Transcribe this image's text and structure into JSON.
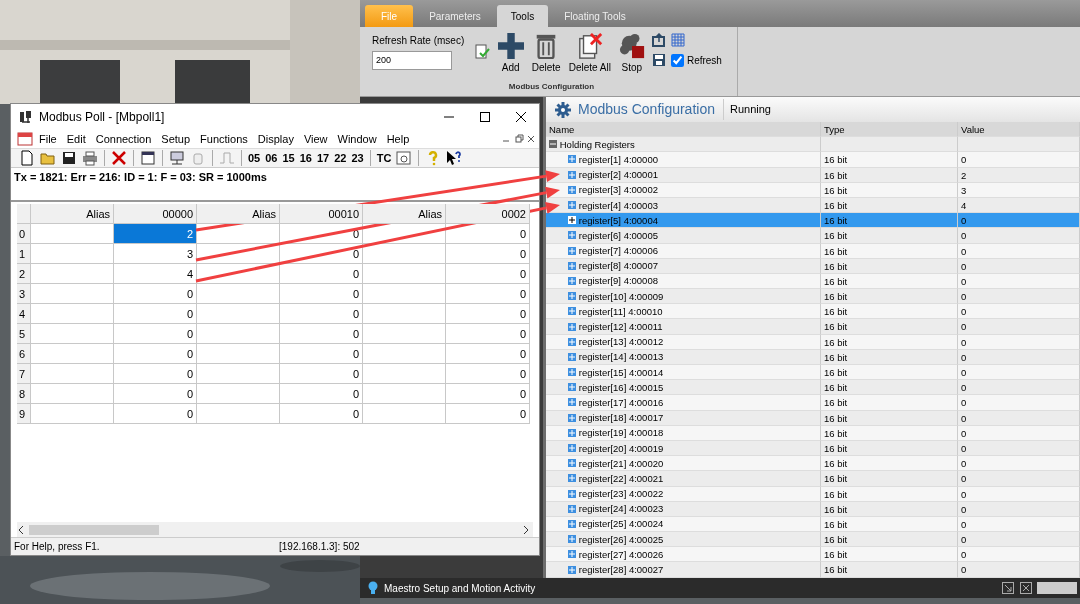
{
  "ribbon": {
    "file_button": "File",
    "tabs": [
      {
        "label": "Parameters",
        "selected": false
      },
      {
        "label": "Tools",
        "selected": true
      },
      {
        "label": "Floating Tools",
        "selected": false
      }
    ],
    "refresh_rate": {
      "label": "Refresh Rate (msec)",
      "value": "200"
    },
    "tools": [
      {
        "label": "Add",
        "kind": "add"
      },
      {
        "label": "Delete",
        "kind": "delete"
      },
      {
        "label": "Delete All",
        "kind": "delete_all"
      },
      {
        "label": "Stop",
        "kind": "stop"
      }
    ],
    "refresh_checkbox": {
      "label": "Refresh",
      "checked": true
    },
    "group_label": "Modbus Configuration"
  },
  "config": {
    "title": "Modbus Configuration",
    "status": "Running",
    "columns": [
      "Name",
      "Type",
      "Value"
    ],
    "group": {
      "label": "Holding Registers",
      "expanded": true
    },
    "rows": [
      {
        "name": "register[1] 4:00000",
        "type": "16 bit",
        "value": "0",
        "selected": false
      },
      {
        "name": "register[2] 4:00001",
        "type": "16 bit",
        "value": "2",
        "selected": false
      },
      {
        "name": "register[3] 4:00002",
        "type": "16 bit",
        "value": "3",
        "selected": false
      },
      {
        "name": "register[4] 4:00003",
        "type": "16 bit",
        "value": "4",
        "selected": false
      },
      {
        "name": "register[5] 4:00004",
        "type": "16 bit",
        "value": "0",
        "selected": true
      },
      {
        "name": "register[6] 4:00005",
        "type": "16 bit",
        "value": "0",
        "selected": false
      },
      {
        "name": "register[7] 4:00006",
        "type": "16 bit",
        "value": "0",
        "selected": false
      },
      {
        "name": "register[8] 4:00007",
        "type": "16 bit",
        "value": "0",
        "selected": false
      },
      {
        "name": "register[9] 4:00008",
        "type": "16 bit",
        "value": "0",
        "selected": false
      },
      {
        "name": "register[10] 4:00009",
        "type": "16 bit",
        "value": "0",
        "selected": false
      },
      {
        "name": "register[11] 4:00010",
        "type": "16 bit",
        "value": "0",
        "selected": false
      },
      {
        "name": "register[12] 4:00011",
        "type": "16 bit",
        "value": "0",
        "selected": false
      },
      {
        "name": "register[13] 4:00012",
        "type": "16 bit",
        "value": "0",
        "selected": false
      },
      {
        "name": "register[14] 4:00013",
        "type": "16 bit",
        "value": "0",
        "selected": false
      },
      {
        "name": "register[15] 4:00014",
        "type": "16 bit",
        "value": "0",
        "selected": false
      },
      {
        "name": "register[16] 4:00015",
        "type": "16 bit",
        "value": "0",
        "selected": false
      },
      {
        "name": "register[17] 4:00016",
        "type": "16 bit",
        "value": "0",
        "selected": false
      },
      {
        "name": "register[18] 4:00017",
        "type": "16 bit",
        "value": "0",
        "selected": false
      },
      {
        "name": "register[19] 4:00018",
        "type": "16 bit",
        "value": "0",
        "selected": false
      },
      {
        "name": "register[20] 4:00019",
        "type": "16 bit",
        "value": "0",
        "selected": false
      },
      {
        "name": "register[21] 4:00020",
        "type": "16 bit",
        "value": "0",
        "selected": false
      },
      {
        "name": "register[22] 4:00021",
        "type": "16 bit",
        "value": "0",
        "selected": false
      },
      {
        "name": "register[23] 4:00022",
        "type": "16 bit",
        "value": "0",
        "selected": false
      },
      {
        "name": "register[24] 4:00023",
        "type": "16 bit",
        "value": "0",
        "selected": false
      },
      {
        "name": "register[25] 4:00024",
        "type": "16 bit",
        "value": "0",
        "selected": false
      },
      {
        "name": "register[26] 4:00025",
        "type": "16 bit",
        "value": "0",
        "selected": false
      },
      {
        "name": "register[27] 4:00026",
        "type": "16 bit",
        "value": "0",
        "selected": false
      },
      {
        "name": "register[28] 4:00027",
        "type": "16 bit",
        "value": "0",
        "selected": false
      }
    ]
  },
  "activity_bar": {
    "title": "Maestro Setup and Motion Activity"
  },
  "poll": {
    "title": "Modbus Poll - [Mbpoll1]",
    "menu": [
      "File",
      "Edit",
      "Connection",
      "Setup",
      "Functions",
      "Display",
      "View",
      "Window",
      "Help"
    ],
    "function_codes": [
      "05",
      "06",
      "15",
      "16",
      "17",
      "22",
      "23"
    ],
    "test_button": "TC",
    "status_line": "Tx = 1821: Err = 216: ID = 1: F = 03: SR = 1000ms",
    "columns": [
      "Alias",
      "00000",
      "Alias",
      "00010",
      "Alias",
      "0002"
    ],
    "rows": [
      {
        "label": "0",
        "cells": [
          {
            "selected": false
          },
          {
            "value": "2",
            "selected": true
          },
          {
            "selected": false
          },
          {
            "value": "0",
            "selected": false
          },
          {
            "selected": false
          },
          {
            "value": "0",
            "selected": false
          }
        ]
      },
      {
        "label": "1",
        "cells": [
          {
            "selected": false
          },
          {
            "value": "3",
            "selected": false
          },
          {
            "selected": false
          },
          {
            "value": "0",
            "selected": false
          },
          {
            "selected": false
          },
          {
            "value": "0",
            "selected": false
          }
        ]
      },
      {
        "label": "2",
        "cells": [
          {
            "selected": false
          },
          {
            "value": "4",
            "selected": false
          },
          {
            "selected": false
          },
          {
            "value": "0",
            "selected": false
          },
          {
            "selected": false
          },
          {
            "value": "0",
            "selected": false
          }
        ]
      },
      {
        "label": "3",
        "cells": [
          {
            "selected": false
          },
          {
            "value": "0",
            "selected": false
          },
          {
            "selected": false
          },
          {
            "value": "0",
            "selected": false
          },
          {
            "selected": false
          },
          {
            "value": "0",
            "selected": false
          }
        ]
      },
      {
        "label": "4",
        "cells": [
          {
            "selected": false
          },
          {
            "value": "0",
            "selected": false
          },
          {
            "selected": false
          },
          {
            "value": "0",
            "selected": false
          },
          {
            "selected": false
          },
          {
            "value": "0",
            "selected": false
          }
        ]
      },
      {
        "label": "5",
        "cells": [
          {
            "selected": false
          },
          {
            "value": "0",
            "selected": false
          },
          {
            "selected": false
          },
          {
            "value": "0",
            "selected": false
          },
          {
            "selected": false
          },
          {
            "value": "0",
            "selected": false
          }
        ]
      },
      {
        "label": "6",
        "cells": [
          {
            "selected": false
          },
          {
            "value": "0",
            "selected": false
          },
          {
            "selected": false
          },
          {
            "value": "0",
            "selected": false
          },
          {
            "selected": false
          },
          {
            "value": "0",
            "selected": false
          }
        ]
      },
      {
        "label": "7",
        "cells": [
          {
            "selected": false
          },
          {
            "value": "0",
            "selected": false
          },
          {
            "selected": false
          },
          {
            "value": "0",
            "selected": false
          },
          {
            "selected": false
          },
          {
            "value": "0",
            "selected": false
          }
        ]
      },
      {
        "label": "8",
        "cells": [
          {
            "selected": false
          },
          {
            "value": "0",
            "selected": false
          },
          {
            "selected": false
          },
          {
            "value": "0",
            "selected": false
          },
          {
            "selected": false
          },
          {
            "value": "0",
            "selected": false
          }
        ]
      },
      {
        "label": "9",
        "cells": [
          {
            "selected": false
          },
          {
            "value": "0",
            "selected": false
          },
          {
            "selected": false
          },
          {
            "value": "0",
            "selected": false
          },
          {
            "selected": false
          },
          {
            "value": "0",
            "selected": false
          }
        ]
      }
    ],
    "status_bar": {
      "help": "For Help, press F1.",
      "address": "[192.168.1.3]: 502"
    }
  }
}
